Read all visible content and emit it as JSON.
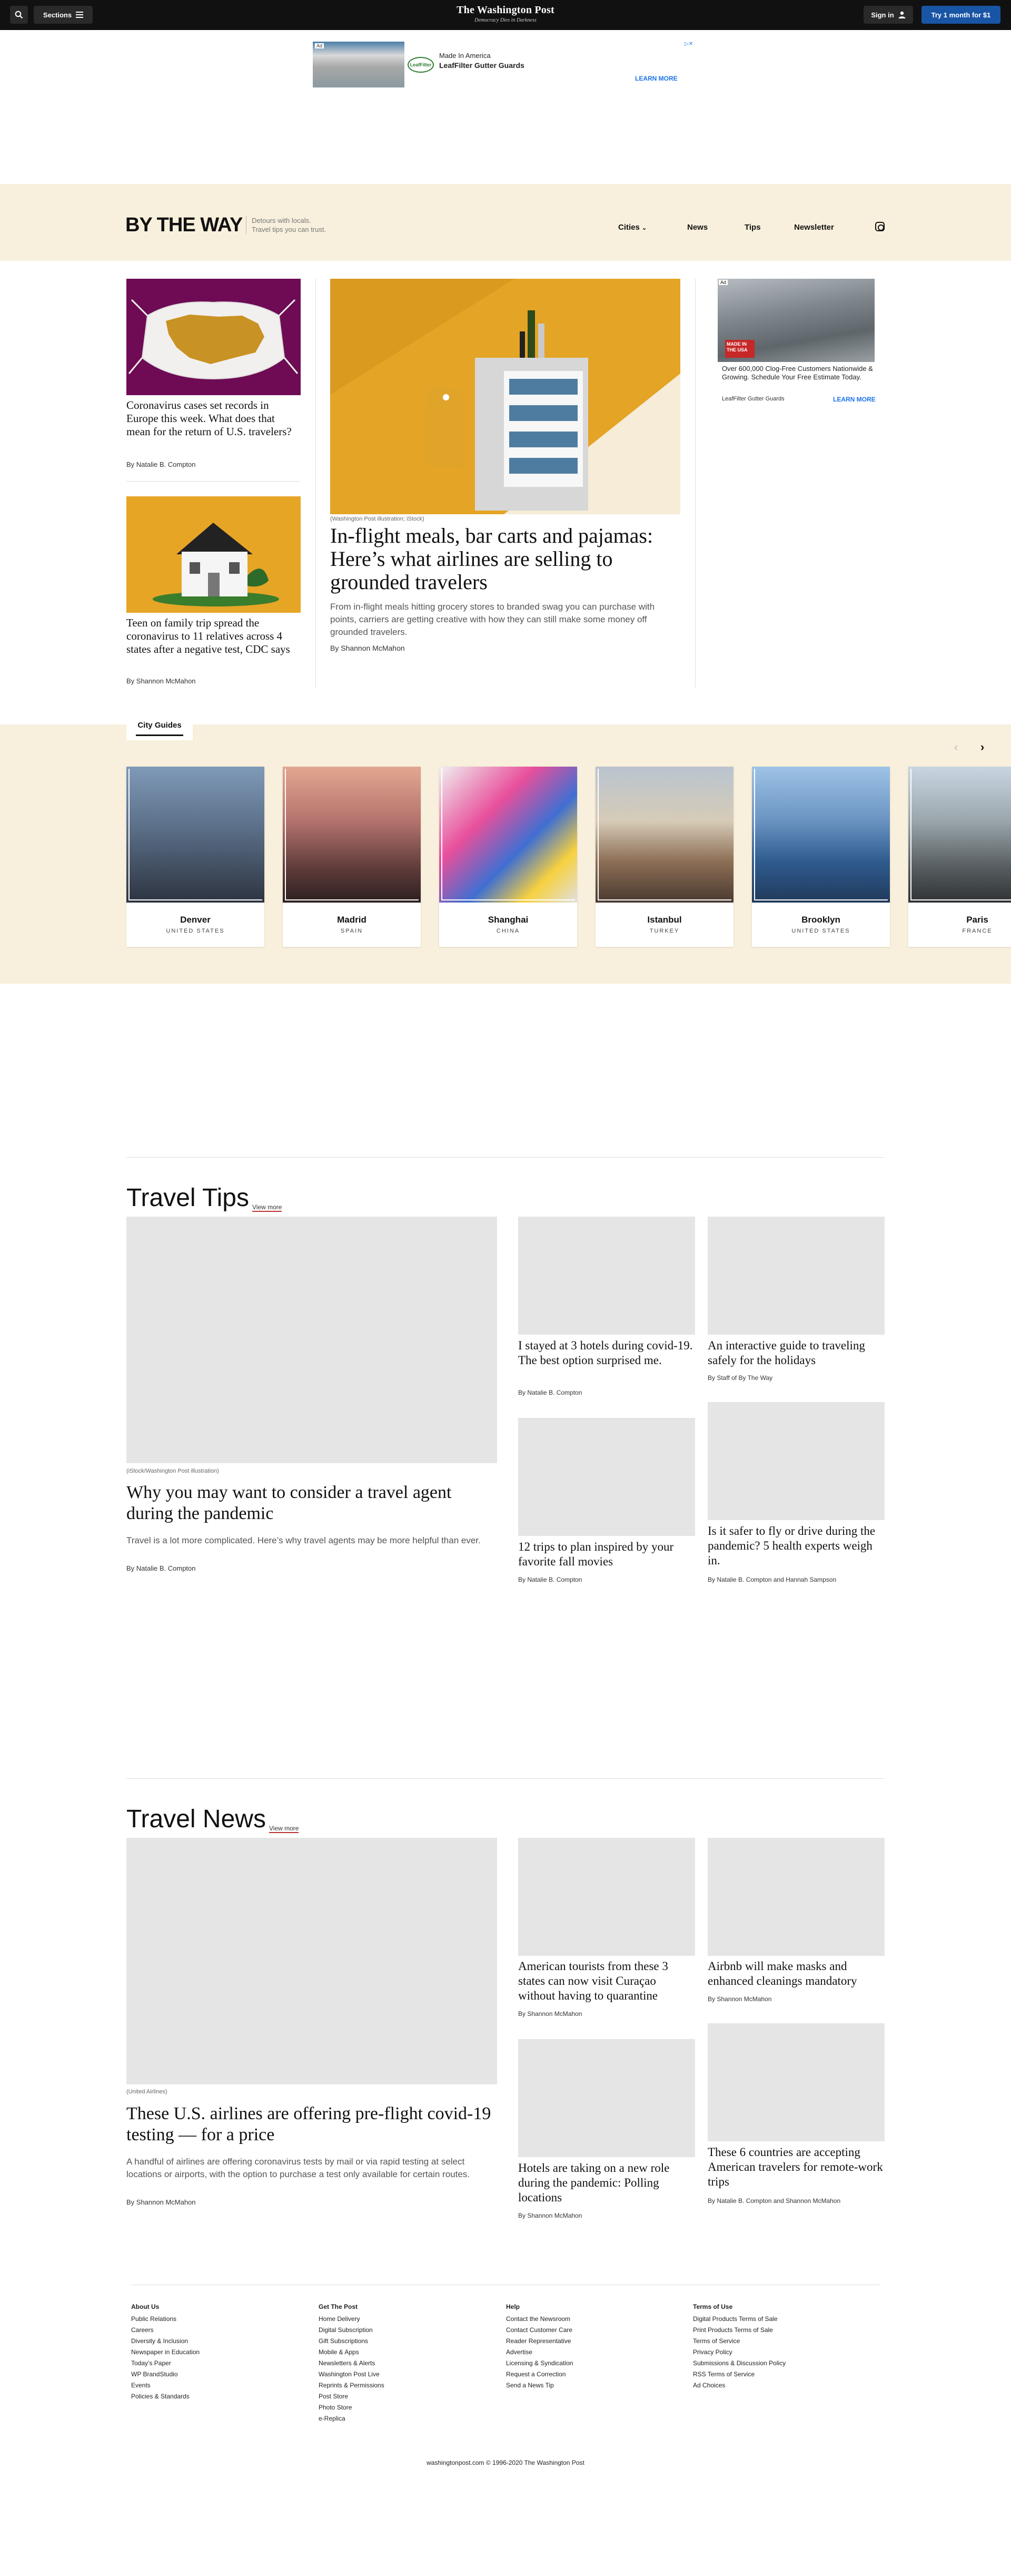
{
  "topbar": {
    "sections_label": "Sections",
    "logo": "The Washington Post",
    "tagline": "Democracy Dies in Darkness",
    "signin_label": "Sign in",
    "subscribe_label": "Try 1 month for $1"
  },
  "top_ad": {
    "badge": "Ad",
    "close": "▷✕",
    "line1": "Made In America",
    "line2": "LeafFilter Gutter Guards",
    "logo": "LeafFilter",
    "cta": "LEARN MORE"
  },
  "brand": {
    "logo": "BY THE WAY",
    "tagline_1": "Detours with locals.",
    "tagline_2": "Travel tips you can trust.",
    "nav": [
      "Cities",
      "News",
      "Tips",
      "Newsletter"
    ]
  },
  "hero": {
    "left": [
      {
        "title": "Coronavirus cases set records in Europe this week. What does that mean for the return of U.S. travelers?",
        "byline": "By Natalie B. Compton"
      },
      {
        "title": "Teen on family trip spread the coronavirus to 11 relatives across 4 states after a negative test, CDC says",
        "byline": "By Shannon McMahon"
      }
    ],
    "main": {
      "caption": "(Washington Post illustration; iStock)",
      "title": "In-flight meals, bar carts and pajamas: Here’s what airlines are selling to grounded travelers",
      "blurb": "From in-flight meals hitting grocery stores to branded swag you can purchase with points, carriers are getting creative with how they can still make some money off grounded travelers.",
      "byline": "By Shannon McMahon"
    }
  },
  "side_ad": {
    "badge": "Ad",
    "flag_text": "MADE IN THE USA",
    "text": "Over 600,000 Clog-Free Customers Nationwide & Growing. Schedule Your Free Estimate Today.",
    "logo": "LeafFilter Gutter Guards",
    "cta": "LEARN MORE"
  },
  "city_guides": {
    "tab": "City Guides",
    "prev": "‹",
    "next": "›",
    "cities": [
      {
        "name": "Denver",
        "country": "UNITED STATES"
      },
      {
        "name": "Madrid",
        "country": "SPAIN"
      },
      {
        "name": "Shanghai",
        "country": "CHINA"
      },
      {
        "name": "Istanbul",
        "country": "TURKEY"
      },
      {
        "name": "Brooklyn",
        "country": "UNITED STATES"
      },
      {
        "name": "Paris",
        "country": "FRANCE"
      }
    ]
  },
  "travel_tips": {
    "title": "Travel Tips",
    "more": "View more",
    "lead": {
      "caption": "(iStock/Washington Post illustration)",
      "title": "Why you may want to consider a travel agent during the pandemic",
      "blurb": "Travel is a lot more complicated. Here’s why travel agents may be more helpful than ever.",
      "byline": "By Natalie B. Compton"
    },
    "items": [
      {
        "title": "I stayed at 3 hotels during covid-19. The best option surprised me.",
        "byline": "By Natalie B. Compton"
      },
      {
        "title": "An interactive guide to traveling safely for the holidays",
        "byline": "By Staff of By The Way"
      },
      {
        "title": "12 trips to plan inspired by your favorite fall movies",
        "byline": "By Natalie B. Compton"
      },
      {
        "title": "Is it safer to fly or drive during the pandemic? 5 health experts weigh in.",
        "byline": "By Natalie B. Compton and Hannah Sampson"
      }
    ]
  },
  "travel_news": {
    "title": "Travel News",
    "more": "View more",
    "lead": {
      "caption": "(United Airlines)",
      "title": "These U.S. airlines are offering pre-flight covid-19 testing — for a price",
      "blurb": "A handful of airlines are offering coronavirus tests by mail or via rapid testing at select locations or airports, with the option to purchase a test only available for certain routes.",
      "byline": "By Shannon McMahon"
    },
    "items": [
      {
        "title": "American tourists from these 3 states can now visit Curaçao without having to quarantine",
        "byline": "By Shannon McMahon"
      },
      {
        "title": "Airbnb will make masks and enhanced cleanings mandatory",
        "byline": "By Shannon McMahon"
      },
      {
        "title": "Hotels are taking on a new role during the pandemic: Polling locations",
        "byline": "By Shannon McMahon"
      },
      {
        "title": "These 6 countries are accepting American travelers for remote-work trips",
        "byline": "By Natalie B. Compton and Shannon McMahon"
      }
    ]
  },
  "footer": {
    "columns": [
      {
        "heading": "About Us",
        "links": [
          "Public Relations",
          "Careers",
          "Diversity & Inclusion",
          "Newspaper in Education",
          "Today’s Paper",
          "WP BrandStudio",
          "Events",
          "Policies & Standards"
        ]
      },
      {
        "heading": "Get The Post",
        "links": [
          "Home Delivery",
          "Digital Subscription",
          "Gift Subscriptions",
          "Mobile & Apps",
          "Newsletters & Alerts",
          "Washington Post Live",
          "Reprints & Permissions",
          "Post Store",
          "Photo Store",
          "e-Replica"
        ]
      },
      {
        "heading": "Help",
        "links": [
          "Contact the Newsroom",
          "Contact Customer Care",
          "Reader Representative",
          "Advertise",
          "Licensing & Syndication",
          "Request a Correction",
          "Send a News Tip"
        ]
      },
      {
        "heading": "Terms of Use",
        "links": [
          "Digital Products Terms of Sale",
          "Print Products Terms of Sale",
          "Terms of Service",
          "Privacy Policy",
          "Submissions & Discussion Policy",
          "RSS Terms of Service",
          "Ad Choices"
        ]
      }
    ],
    "copyright": "washingtonpost.com © 1996-2020 The Washington Post"
  }
}
